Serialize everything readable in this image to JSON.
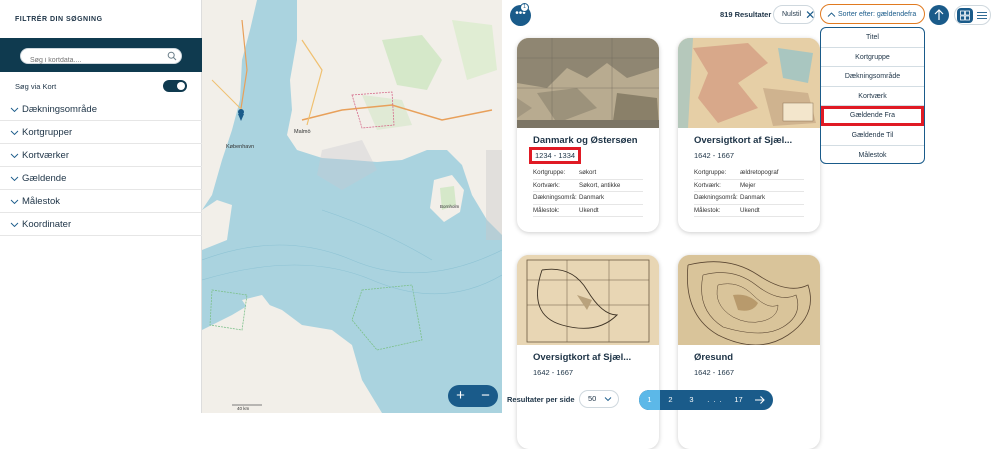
{
  "sidebar": {
    "title": "FILTRÉR DIN SØGNING",
    "search_placeholder": "Søg i kortdata....",
    "map_toggle_label": "Søg via Kort",
    "map_toggle_on": true,
    "filters": [
      {
        "label": "Dækningsområde"
      },
      {
        "label": "Kortgrupper"
      },
      {
        "label": "Kortværker"
      },
      {
        "label": "Gældende"
      },
      {
        "label": "Målestok"
      },
      {
        "label": "Koordinater"
      }
    ]
  },
  "map": {
    "labels": {
      "copenhagen": "København",
      "malmo": "Malmö",
      "bornholm": "Bornholm",
      "scale": "40 km"
    }
  },
  "toolbar": {
    "more_badge": "1",
    "result_count": "819 Resultater",
    "reset_label": "Nulstil",
    "sort_label": "Sorter efter: gældendefra"
  },
  "sort_options": [
    {
      "label": "Titel",
      "selected": false
    },
    {
      "label": "Kortgruppe",
      "selected": false
    },
    {
      "label": "Dækningsområde",
      "selected": false
    },
    {
      "label": "Kortværk",
      "selected": false
    },
    {
      "label": "Gældende Fra",
      "selected": true
    },
    {
      "label": "Gældende Til",
      "selected": false
    },
    {
      "label": "Målestok",
      "selected": false
    }
  ],
  "cards": [
    {
      "title": "Danmark og Østersøen",
      "years": "1234 - 1334",
      "meta": [
        {
          "k": "Kortgruppe:",
          "v": "søkort"
        },
        {
          "k": "Kortværk:",
          "v": "Søkort, antikke"
        },
        {
          "k": "Dækningsområ:",
          "v": "Danmark"
        },
        {
          "k": "Målestok:",
          "v": "Ukendt"
        }
      ]
    },
    {
      "title": "Oversigtkort af Sjæl...",
      "years": "1642 - 1667",
      "meta": [
        {
          "k": "Kortgruppe:",
          "v": "ældretopograf"
        },
        {
          "k": "Kortværk:",
          "v": "Mejer"
        },
        {
          "k": "Dækningsområ:",
          "v": "Danmark"
        },
        {
          "k": "Målestok:",
          "v": "Ukendt"
        }
      ]
    },
    {
      "title": "Oversigtkort af Sjæl...",
      "years": "1642 - 1667"
    },
    {
      "title": "Øresund",
      "years": "1642 - 1667"
    }
  ],
  "footer": {
    "per_page_label": "Resultater per side",
    "per_page_value": "50",
    "pages": [
      "1",
      "2",
      "3",
      ". . .",
      "17"
    ]
  },
  "colors": {
    "brand": "#1a5b8a",
    "sidebar_dark": "#0f3a4f",
    "sort_outline": "#e07a20",
    "highlight": "#e01a24",
    "pager_active": "#5cb8e8"
  }
}
